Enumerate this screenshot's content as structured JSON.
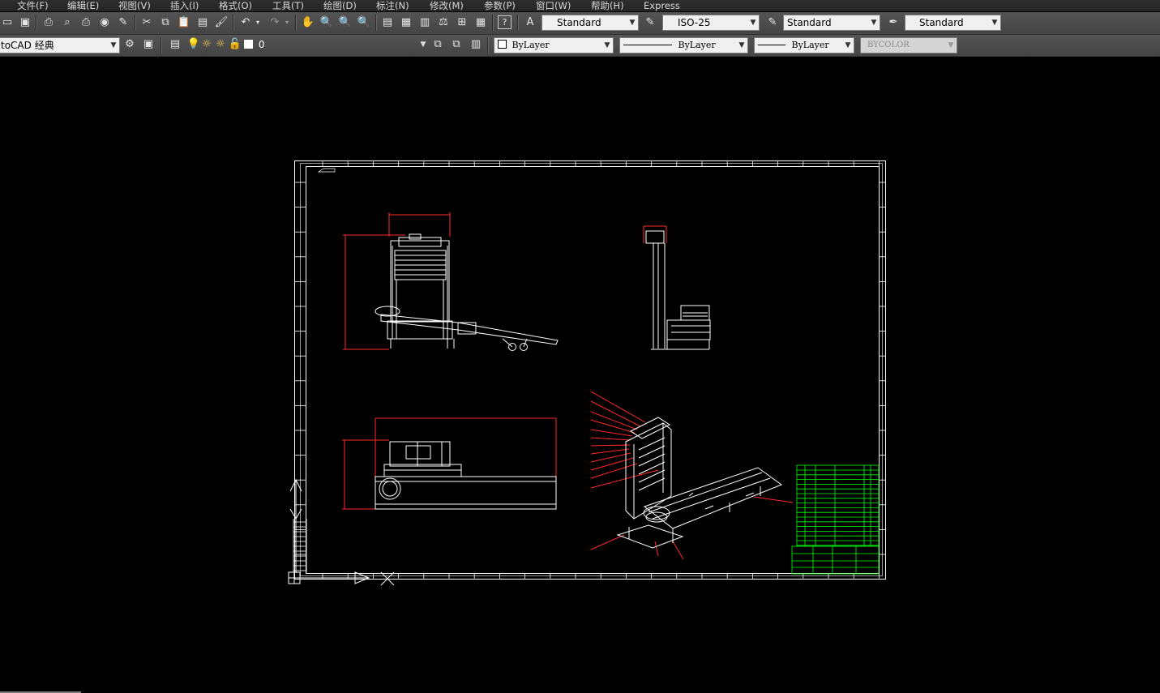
{
  "menu": [
    "文件(F)",
    "编辑(E)",
    "视图(V)",
    "插入(I)",
    "格式(O)",
    "工具(T)",
    "绘图(D)",
    "标注(N)",
    "修改(M)",
    "参数(P)",
    "窗口(W)",
    "帮助(H)",
    "Express"
  ],
  "styles": {
    "text_style": "Standard",
    "dim_style": "ISO-25",
    "table_style": "Standard",
    "multileader_style": "Standard"
  },
  "workspace": "toCAD 经典",
  "layer": {
    "name": "0"
  },
  "properties": {
    "color": "ByLayer",
    "linetype": "ByLayer",
    "lineweight": "ByLayer",
    "plot_style": "BYCOLOR"
  },
  "colors": {
    "geometry": "#ffffff",
    "dimensions": "#ff0000",
    "title_block": "#00ff00",
    "model_space": "#000000",
    "toolbar": "#4a4a4a"
  }
}
